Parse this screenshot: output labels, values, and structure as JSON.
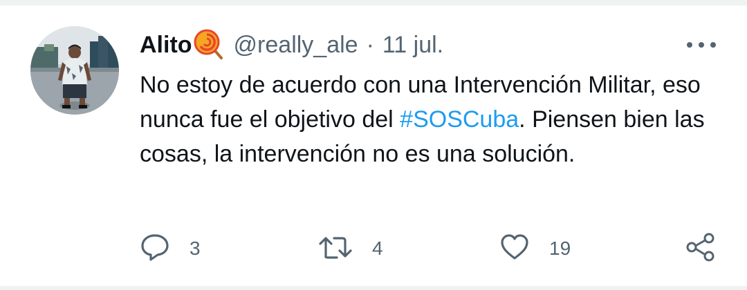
{
  "tweet": {
    "author": {
      "display_name": "Alito",
      "name_emoji": "lollipop-emoji",
      "handle": "@really_ale",
      "avatar": "profile-photo"
    },
    "separator": "·",
    "date": "11 jul.",
    "text_before_hashtag": "No estoy de acuerdo con una Intervención Militar, eso nunca fue el objetivo del ",
    "hashtag": "#SOSCuba",
    "text_after_hashtag": ". Piensen bien las cosas, la intervención no es una solución.",
    "more_icon": "more-dots-icon"
  },
  "actions": {
    "reply": {
      "icon": "reply-icon",
      "count": "3"
    },
    "retweet": {
      "icon": "retweet-icon",
      "count": "4"
    },
    "like": {
      "icon": "heart-icon",
      "count": "19"
    },
    "share": {
      "icon": "share-icon"
    }
  },
  "colors": {
    "text": "#0f1419",
    "secondary": "#536471",
    "link": "#1d9bf0",
    "border": "#eff3f4"
  }
}
